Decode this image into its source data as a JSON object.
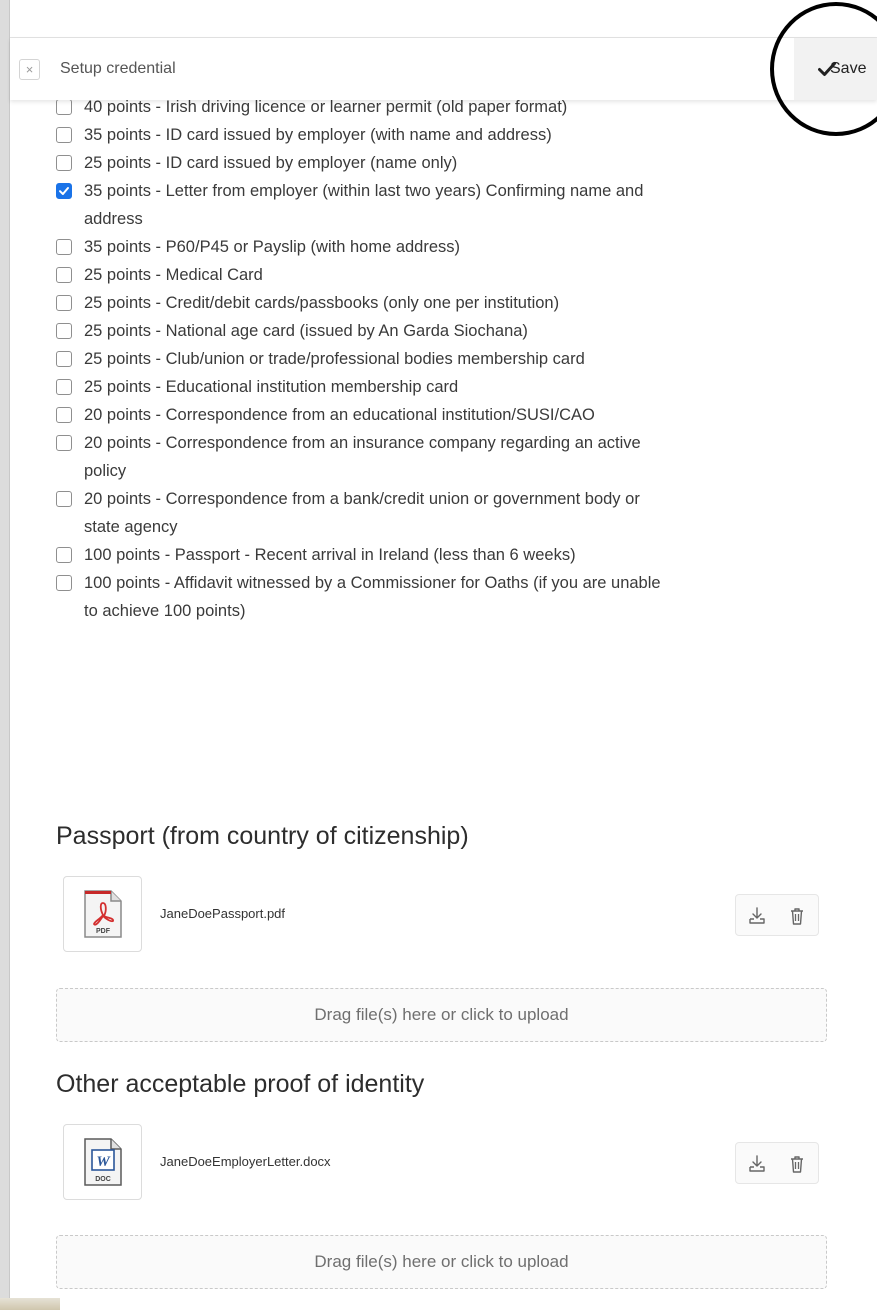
{
  "toolbar": {
    "title": "Setup credential",
    "close_glyph": "×",
    "save_label": "Save",
    "save_icon": "check-icon"
  },
  "options": [
    {
      "label": "40 points - Irish driving licence or learner permit (old paper format)",
      "checked": false
    },
    {
      "label": "35 points - ID card issued by employer (with name and address)",
      "checked": false
    },
    {
      "label": "25 points - ID card issued by employer (name only)",
      "checked": false
    },
    {
      "label": "35 points - Letter from employer (within last two years) Confirming name and address",
      "checked": true
    },
    {
      "label": "35 points - P60/P45 or Payslip (with home address)",
      "checked": false
    },
    {
      "label": "25 points - Medical Card",
      "checked": false
    },
    {
      "label": "25 points - Credit/debit cards/passbooks (only one per institution)",
      "checked": false
    },
    {
      "label": "25 points - National age card (issued by An Garda Siochana)",
      "checked": false
    },
    {
      "label": "25 points - Club/union or trade/professional bodies membership card",
      "checked": false
    },
    {
      "label": "25 points - Educational institution membership card",
      "checked": false
    },
    {
      "label": "20 points - Correspondence from an educational institution/SUSI/CAO",
      "checked": false
    },
    {
      "label": "20 points - Correspondence from an insurance company regarding an active policy",
      "checked": false
    },
    {
      "label": "20 points - Correspondence from a bank/credit union or government body or state agency",
      "checked": false
    },
    {
      "label": "100 points - Passport - Recent arrival in Ireland (less than 6 weeks)",
      "checked": false
    },
    {
      "label": "100 points - Affidavit witnessed by a Commissioner for Oaths (if you are unable to achieve 100 points)",
      "checked": false
    }
  ],
  "sections": [
    {
      "title": "Passport (from country of citizenship)",
      "file": {
        "name": "JaneDoePassport.pdf",
        "type_label": "PDF",
        "icon": "pdf-file-icon"
      },
      "dropzone": "Drag file(s) here or click to upload"
    },
    {
      "title": "Other acceptable proof of identity",
      "file": {
        "name": "JaneDoeEmployerLetter.docx",
        "type_label": "DOC",
        "icon": "word-file-icon"
      },
      "dropzone": "Drag file(s) here or click to upload"
    }
  ],
  "colors": {
    "checkbox_checked": "#1a73e8",
    "pdf_red": "#d32f2f",
    "word_blue": "#2b579a"
  }
}
